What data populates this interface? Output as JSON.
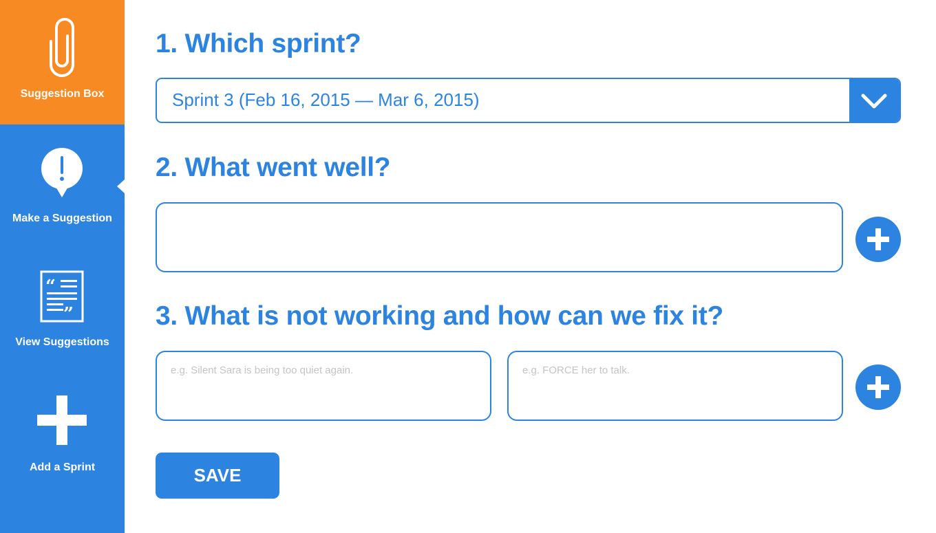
{
  "sidebar": {
    "brand": {
      "label": "Suggestion Box",
      "icon": "paperclip-icon",
      "color": "#f78a22"
    },
    "items": [
      {
        "label": "Make a Suggestion",
        "icon": "exclamation-bubble-icon",
        "active": true
      },
      {
        "label": "View Suggestions",
        "icon": "quote-document-icon",
        "active": false
      },
      {
        "label": "Add a Sprint",
        "icon": "plus-icon",
        "active": false
      }
    ],
    "color": "#2c84e0"
  },
  "form": {
    "q1": {
      "title": "1. Which sprint?",
      "selected": "Sprint 3 (Feb 16, 2015 — Mar 6, 2015)"
    },
    "q2": {
      "title": "2. What went well?",
      "value": "",
      "placeholder": ""
    },
    "q3": {
      "title": "3. What is not working and how can we fix it?",
      "problem_placeholder": "e.g. Silent Sara is being too quiet again.",
      "fix_placeholder": "e.g. FORCE her to talk."
    },
    "save_label": "SAVE"
  },
  "colors": {
    "accent": "#2c84e0",
    "brand": "#f78a22",
    "placeholder": "#c4c4c4"
  }
}
